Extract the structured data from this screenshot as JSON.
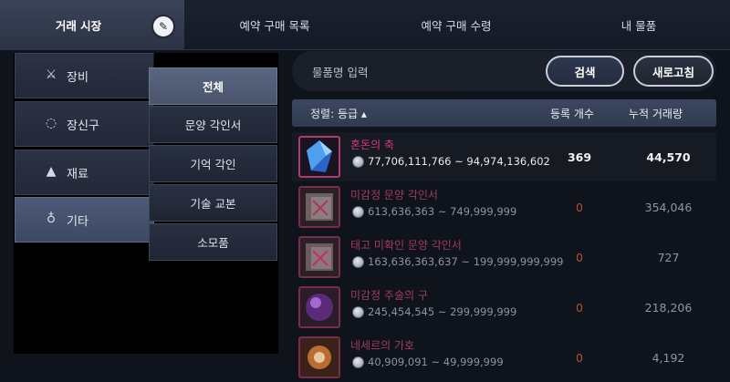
{
  "tabs": [
    {
      "label": "거래 시장",
      "active": true
    },
    {
      "label": "예약 구매 목록"
    },
    {
      "label": "예약 구매 수령"
    },
    {
      "label": "내 물품"
    }
  ],
  "categories": [
    {
      "label": "장비",
      "icon": "swords-icon"
    },
    {
      "label": "장신구",
      "icon": "ring-icon"
    },
    {
      "label": "재료",
      "icon": "flask-icon"
    },
    {
      "label": "기타",
      "icon": "potion-icon",
      "active": true
    }
  ],
  "subcategories": [
    {
      "label": "전체",
      "active": true
    },
    {
      "label": "문양 각인서"
    },
    {
      "label": "기억 각인"
    },
    {
      "label": "기술 교본"
    },
    {
      "label": "소모품"
    }
  ],
  "search": {
    "placeholder": "물품명 입력",
    "search_label": "검색",
    "refresh_label": "새로고침"
  },
  "table": {
    "headers": {
      "sort": "정렬: 등급 ▴",
      "count": "등록 개수",
      "volume": "누적 거래량"
    },
    "rows": [
      {
        "name": "혼돈의 축",
        "price": "77,706,111,766 ~ 94,974,136,602",
        "count": "369",
        "volume": "44,570"
      },
      {
        "name": "미감정 문양 각인서",
        "price": "613,636,363 ~ 749,999,999",
        "count": "0",
        "volume": "354,046"
      },
      {
        "name": "태고 미확인 문양 각인서",
        "price": "163,636,363,637 ~ 199,999,999,999",
        "count": "0",
        "volume": "727"
      },
      {
        "name": "미감정 주술의 구",
        "price": "245,454,545 ~ 299,999,999",
        "count": "0",
        "volume": "218,206"
      },
      {
        "name": "네세르의 가호",
        "price": "40,909,091 ~ 49,999,999",
        "count": "0",
        "volume": "4,192"
      }
    ]
  },
  "colors": {
    "accent_magenta": "#d7397a",
    "zero_count_orange": "#b2552e",
    "header_bar": "#3c4760",
    "active_category": "#4d5a78"
  }
}
